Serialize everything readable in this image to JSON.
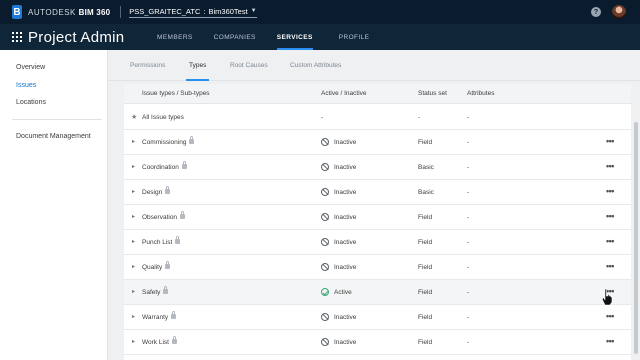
{
  "topbar": {
    "logo_letter": "B",
    "brand": "AUTODESK",
    "product": "BIM 360",
    "project_account": "PSS_GRAITEC_ATC",
    "project_separator": ":",
    "project_name": "Bim360Test",
    "help_label": "?"
  },
  "header": {
    "title": "Project Admin",
    "nav": [
      "MEMBERS",
      "COMPANIES",
      "SERVICES",
      "PROFILE"
    ],
    "active_nav": "SERVICES"
  },
  "sidebar": {
    "items": [
      "Overview",
      "Issues",
      "Locations"
    ],
    "active": "Issues",
    "secondary": "Document Management"
  },
  "subtabs": {
    "items": [
      "Permissions",
      "Types",
      "Root Causes",
      "Custom Attributes"
    ],
    "active": "Types"
  },
  "table": {
    "headers": {
      "type": "Issue types / Sub-types",
      "active": "Active / Inactive",
      "status_set": "Status set",
      "attributes": "Attributes"
    },
    "all_row": {
      "label": "All Issue types",
      "active": "-",
      "status_set": "-",
      "attributes": "-"
    },
    "rows": [
      {
        "name": "Commissioning",
        "state": "Inactive",
        "status_set": "Field",
        "attributes": "-"
      },
      {
        "name": "Coordination",
        "state": "Inactive",
        "status_set": "Basic",
        "attributes": "-"
      },
      {
        "name": "Design",
        "state": "Inactive",
        "status_set": "Basic",
        "attributes": "-"
      },
      {
        "name": "Observation",
        "state": "Inactive",
        "status_set": "Field",
        "attributes": "-"
      },
      {
        "name": "Punch List",
        "state": "Inactive",
        "status_set": "Field",
        "attributes": "-"
      },
      {
        "name": "Quality",
        "state": "Inactive",
        "status_set": "Field",
        "attributes": "-"
      },
      {
        "name": "Safety",
        "state": "Active",
        "status_set": "Field",
        "attributes": "-"
      },
      {
        "name": "Warranty",
        "state": "Inactive",
        "status_set": "Field",
        "attributes": "-"
      },
      {
        "name": "Work List",
        "state": "Inactive",
        "status_set": "Field",
        "attributes": "-"
      }
    ],
    "more_label": "•••"
  },
  "colors": {
    "accent": "#2a8df0",
    "topbar": "#0a1b2e",
    "header": "#0f2538",
    "active_green": "#3aa776"
  }
}
